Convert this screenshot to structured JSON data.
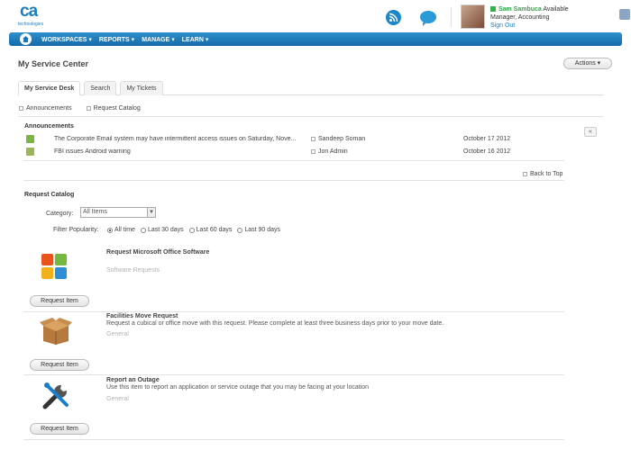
{
  "logo": {
    "brand": "ca",
    "sub": "technologies"
  },
  "user": {
    "name": "Sam Sambuca",
    "status": "Available",
    "role": "Manager, Accounting",
    "signout": "Sign Out"
  },
  "nav": {
    "items": [
      "WORKSPACES ▾",
      "REPORTS ▾",
      "MANAGE ▾",
      "LEARN ▾"
    ]
  },
  "page": {
    "title": "My Service Center",
    "actions_label": "Actions ▾"
  },
  "tabs": [
    "My Service Desk",
    "Search",
    "My Tickets"
  ],
  "sublinks": [
    "Announcements",
    "Request Catalog"
  ],
  "announcements": {
    "title": "Announcements",
    "rows": [
      {
        "text": "The Corporate Email system may have intermittent access issues on Saturday, Nove...",
        "author": "Sandeep Soman",
        "date": "October 17 2012"
      },
      {
        "text": "FBI issues Android warning",
        "author": "Jon Admin",
        "date": "October 16 2012"
      }
    ],
    "collapse_label": "«",
    "back_to_top": "Back to Top"
  },
  "catalog": {
    "title": "Request Catalog",
    "category_label": "Category:",
    "category_value": "All Items",
    "popularity_label": "Filter Popularity:",
    "popularity_options": [
      {
        "label": "All time",
        "selected": true
      },
      {
        "label": "Last 30 days",
        "selected": false
      },
      {
        "label": "Last 60 days",
        "selected": false
      },
      {
        "label": "Last 90 days",
        "selected": false
      }
    ],
    "items": [
      {
        "title": "Request Microsoft Office Software",
        "desc": "",
        "category": "Software Requests",
        "button": "Request Item",
        "icon": "office-icon"
      },
      {
        "title": "Facilities Move Request",
        "desc": "Request a cubical or office move with this request. Please complete at least three business days prior to your move date.",
        "category": "General",
        "button": "Request Item",
        "icon": "box-icon"
      },
      {
        "title": "Report an Outage",
        "desc": "Use this item to report an application or service outage that you may be facing at your location",
        "category": "General",
        "button": "Request Item",
        "icon": "tools-icon"
      }
    ]
  },
  "colors": {
    "nav": "#1a73b6",
    "accent": "#35a34a",
    "link": "#1a7fc1"
  }
}
